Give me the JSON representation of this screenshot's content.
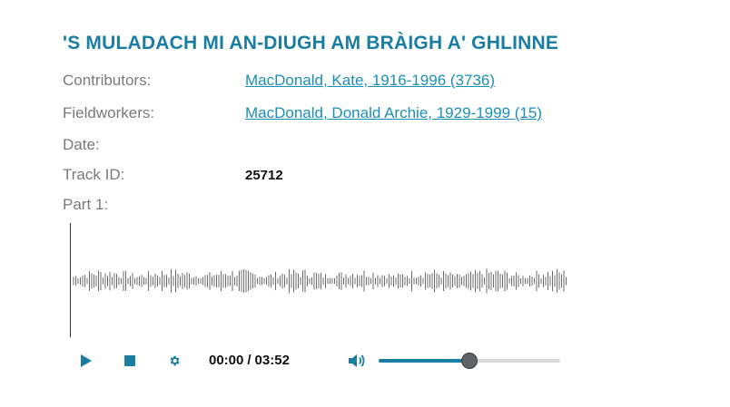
{
  "title": "'S MULADACH MI AN-DIUGH AM BRÀIGH A' GHLINNE",
  "fields": {
    "contributors": {
      "label": "Contributors:",
      "value": "MacDonald, Kate, 1916-1996 (3736)"
    },
    "fieldworkers": {
      "label": "Fieldworkers:",
      "value": "MacDonald, Donald Archie, 1929-1999 (15)"
    },
    "date": {
      "label": "Date:",
      "value": ""
    },
    "track_id": {
      "label": "Track ID:",
      "value": "25712"
    },
    "part": {
      "label": "Part 1:"
    }
  },
  "player": {
    "current_time": "00:00",
    "separator": "/",
    "duration": "03:52",
    "volume_fraction": 0.5,
    "play_icon": "play-icon",
    "stop_icon": "stop-icon",
    "settings_icon": "gear-icon",
    "volume_icon": "speaker-volume-icon"
  },
  "colors": {
    "accent": "#1a7ea3",
    "link": "#1a8fb8",
    "label": "#7a7a7a",
    "waveform": "#6b6b6b"
  }
}
